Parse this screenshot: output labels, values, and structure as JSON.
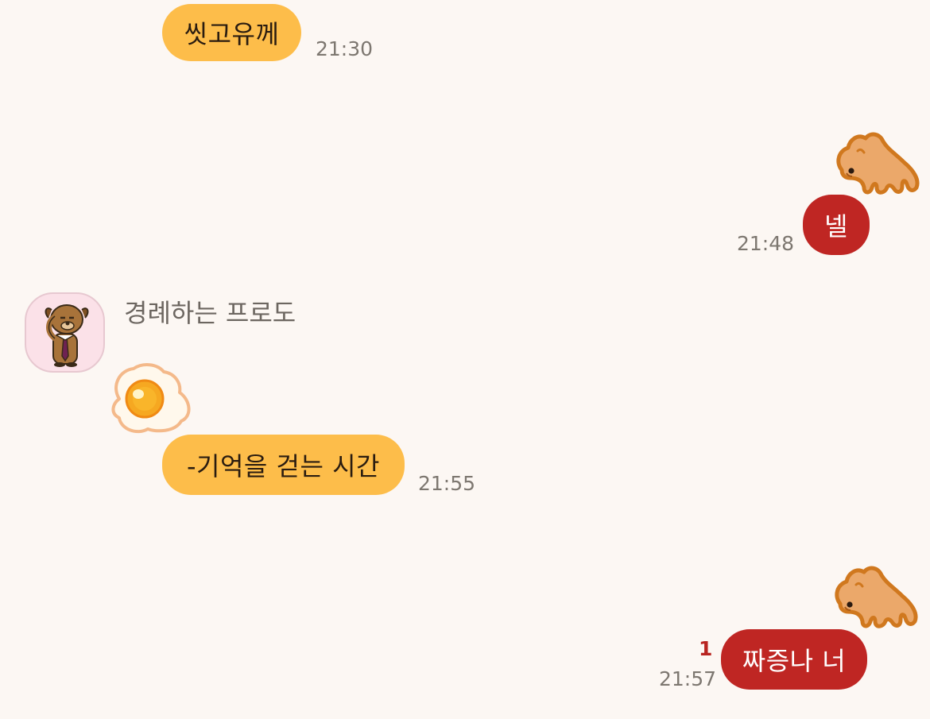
{
  "messages": [
    {
      "id": "m1",
      "direction": "incoming",
      "text": "씻고유께",
      "time": "21:30"
    },
    {
      "id": "m2",
      "direction": "outgoing",
      "sticker": "camel-sticker-icon",
      "text": "넬",
      "time": "21:48"
    },
    {
      "id": "m3",
      "direction": "incoming",
      "sender": "경례하는 프로도",
      "avatar": "frodo-salute-avatar-icon",
      "sticker": "fried-egg-sticker-icon",
      "text": "-기억을 걷는 시간",
      "time": "21:55"
    },
    {
      "id": "m4",
      "direction": "outgoing",
      "sticker": "camel-sticker-icon",
      "text": "짜증나 너",
      "time": "21:57",
      "unread_count": "1"
    }
  ],
  "colors": {
    "background": "#fcf7f3",
    "incoming_bubble": "#fdbd4a",
    "outgoing_bubble": "#bf2623",
    "timestamp": "#7d7770",
    "unread": "#b82420"
  }
}
